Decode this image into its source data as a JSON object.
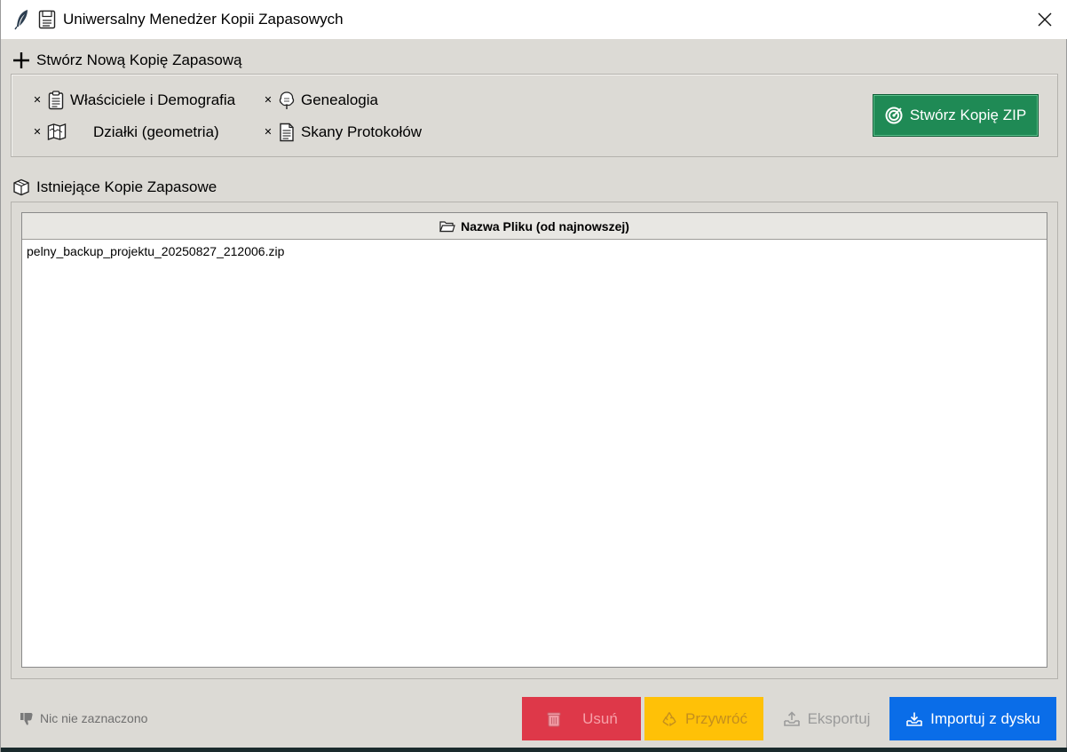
{
  "window": {
    "title": "Uniwersalny Menedżer Kopii Zapasowych",
    "app_icon": "feather-icon",
    "title_icon": "floppy-disk-icon",
    "close_icon": "close-icon"
  },
  "create_section": {
    "label": "Stwórz Nową Kopię Zapasową",
    "icon": "plus-icon",
    "options": [
      {
        "label": "Właściciele i Demografia",
        "icon": "clipboard-icon",
        "checked": true
      },
      {
        "label": "Genealogia",
        "icon": "tree-icon",
        "checked": true
      },
      {
        "label": "Działki (geometria)",
        "icon": "map-icon",
        "checked": true
      },
      {
        "label": "Skany Protokołów",
        "icon": "document-icon",
        "checked": true
      }
    ],
    "check_mark": "✕",
    "create_button": {
      "label": "Stwórz Kopię ZIP",
      "icon": "target-icon"
    }
  },
  "existing_section": {
    "label": "Istniejące Kopie Zapasowe",
    "icon": "package-icon",
    "column_header": "Nazwa Pliku (od najnowszej)",
    "column_icon": "folder-icon",
    "files": [
      "pelny_backup_projektu_20250827_212006.zip"
    ]
  },
  "status": {
    "text": "Nic nie zaznaczono",
    "icon": "thumbs-down-icon"
  },
  "actions": {
    "delete": {
      "label": "Usuń",
      "icon": "trash-icon",
      "color": "#de3849"
    },
    "restore": {
      "label": "Przywróć",
      "icon": "recycle-icon",
      "color": "#ffc107"
    },
    "export": {
      "label": "Eksportuj",
      "icon": "export-tray-icon"
    },
    "import": {
      "label": "Importuj z dysku",
      "icon": "import-tray-icon",
      "color": "#0a6de8"
    }
  },
  "colors": {
    "create_button": "#1f8a55",
    "background": "#dcdad5"
  }
}
